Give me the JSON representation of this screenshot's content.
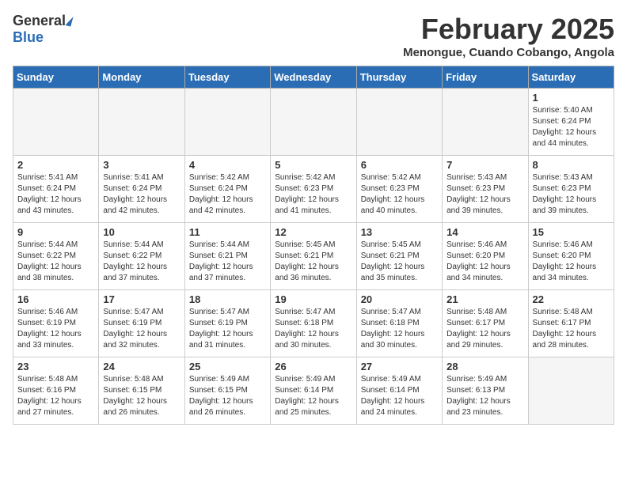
{
  "header": {
    "logo_general": "General",
    "logo_blue": "Blue",
    "title": "February 2025",
    "subtitle": "Menongue, Cuando Cobango, Angola"
  },
  "days_of_week": [
    "Sunday",
    "Monday",
    "Tuesday",
    "Wednesday",
    "Thursday",
    "Friday",
    "Saturday"
  ],
  "weeks": [
    [
      {
        "day": "",
        "info": ""
      },
      {
        "day": "",
        "info": ""
      },
      {
        "day": "",
        "info": ""
      },
      {
        "day": "",
        "info": ""
      },
      {
        "day": "",
        "info": ""
      },
      {
        "day": "",
        "info": ""
      },
      {
        "day": "1",
        "info": "Sunrise: 5:40 AM\nSunset: 6:24 PM\nDaylight: 12 hours and 44 minutes."
      }
    ],
    [
      {
        "day": "2",
        "info": "Sunrise: 5:41 AM\nSunset: 6:24 PM\nDaylight: 12 hours and 43 minutes."
      },
      {
        "day": "3",
        "info": "Sunrise: 5:41 AM\nSunset: 6:24 PM\nDaylight: 12 hours and 42 minutes."
      },
      {
        "day": "4",
        "info": "Sunrise: 5:42 AM\nSunset: 6:24 PM\nDaylight: 12 hours and 42 minutes."
      },
      {
        "day": "5",
        "info": "Sunrise: 5:42 AM\nSunset: 6:23 PM\nDaylight: 12 hours and 41 minutes."
      },
      {
        "day": "6",
        "info": "Sunrise: 5:42 AM\nSunset: 6:23 PM\nDaylight: 12 hours and 40 minutes."
      },
      {
        "day": "7",
        "info": "Sunrise: 5:43 AM\nSunset: 6:23 PM\nDaylight: 12 hours and 39 minutes."
      },
      {
        "day": "8",
        "info": "Sunrise: 5:43 AM\nSunset: 6:23 PM\nDaylight: 12 hours and 39 minutes."
      }
    ],
    [
      {
        "day": "9",
        "info": "Sunrise: 5:44 AM\nSunset: 6:22 PM\nDaylight: 12 hours and 38 minutes."
      },
      {
        "day": "10",
        "info": "Sunrise: 5:44 AM\nSunset: 6:22 PM\nDaylight: 12 hours and 37 minutes."
      },
      {
        "day": "11",
        "info": "Sunrise: 5:44 AM\nSunset: 6:21 PM\nDaylight: 12 hours and 37 minutes."
      },
      {
        "day": "12",
        "info": "Sunrise: 5:45 AM\nSunset: 6:21 PM\nDaylight: 12 hours and 36 minutes."
      },
      {
        "day": "13",
        "info": "Sunrise: 5:45 AM\nSunset: 6:21 PM\nDaylight: 12 hours and 35 minutes."
      },
      {
        "day": "14",
        "info": "Sunrise: 5:46 AM\nSunset: 6:20 PM\nDaylight: 12 hours and 34 minutes."
      },
      {
        "day": "15",
        "info": "Sunrise: 5:46 AM\nSunset: 6:20 PM\nDaylight: 12 hours and 34 minutes."
      }
    ],
    [
      {
        "day": "16",
        "info": "Sunrise: 5:46 AM\nSunset: 6:19 PM\nDaylight: 12 hours and 33 minutes."
      },
      {
        "day": "17",
        "info": "Sunrise: 5:47 AM\nSunset: 6:19 PM\nDaylight: 12 hours and 32 minutes."
      },
      {
        "day": "18",
        "info": "Sunrise: 5:47 AM\nSunset: 6:19 PM\nDaylight: 12 hours and 31 minutes."
      },
      {
        "day": "19",
        "info": "Sunrise: 5:47 AM\nSunset: 6:18 PM\nDaylight: 12 hours and 30 minutes."
      },
      {
        "day": "20",
        "info": "Sunrise: 5:47 AM\nSunset: 6:18 PM\nDaylight: 12 hours and 30 minutes."
      },
      {
        "day": "21",
        "info": "Sunrise: 5:48 AM\nSunset: 6:17 PM\nDaylight: 12 hours and 29 minutes."
      },
      {
        "day": "22",
        "info": "Sunrise: 5:48 AM\nSunset: 6:17 PM\nDaylight: 12 hours and 28 minutes."
      }
    ],
    [
      {
        "day": "23",
        "info": "Sunrise: 5:48 AM\nSunset: 6:16 PM\nDaylight: 12 hours and 27 minutes."
      },
      {
        "day": "24",
        "info": "Sunrise: 5:48 AM\nSunset: 6:15 PM\nDaylight: 12 hours and 26 minutes."
      },
      {
        "day": "25",
        "info": "Sunrise: 5:49 AM\nSunset: 6:15 PM\nDaylight: 12 hours and 26 minutes."
      },
      {
        "day": "26",
        "info": "Sunrise: 5:49 AM\nSunset: 6:14 PM\nDaylight: 12 hours and 25 minutes."
      },
      {
        "day": "27",
        "info": "Sunrise: 5:49 AM\nSunset: 6:14 PM\nDaylight: 12 hours and 24 minutes."
      },
      {
        "day": "28",
        "info": "Sunrise: 5:49 AM\nSunset: 6:13 PM\nDaylight: 12 hours and 23 minutes."
      },
      {
        "day": "",
        "info": ""
      }
    ]
  ]
}
